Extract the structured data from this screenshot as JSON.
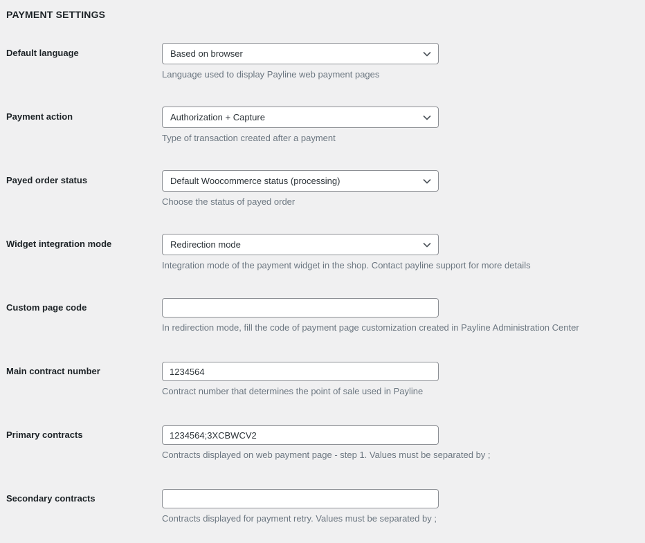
{
  "section": {
    "title": "PAYMENT SETTINGS"
  },
  "icons": {
    "chevron_down": "chevron-down-icon"
  },
  "colors": {
    "background": "#f0f0f1",
    "field_background": "#ffffff",
    "field_border": "#8c8f94",
    "label_text": "#1d2327",
    "value_text": "#2c3338",
    "description_text": "#6c7781"
  },
  "fields": [
    {
      "label": "Default language",
      "type": "select",
      "value": "Based on browser",
      "placeholder": "",
      "description": "Language used to display Payline web payment pages",
      "name": "default-language"
    },
    {
      "label": "Payment action",
      "type": "select",
      "value": "Authorization + Capture",
      "placeholder": "",
      "description": "Type of transaction created after a payment",
      "name": "payment-action"
    },
    {
      "label": "Payed order status",
      "type": "select",
      "value": "Default Woocommerce status (processing)",
      "placeholder": "",
      "description": "Choose the status of payed order",
      "name": "payed-order-status"
    },
    {
      "label": "Widget integration mode",
      "type": "select",
      "value": "Redirection mode",
      "placeholder": "",
      "description": "Integration mode of the payment widget in the shop. Contact payline support for more details",
      "name": "widget-integration-mode"
    },
    {
      "label": "Custom page code",
      "type": "text",
      "value": "",
      "placeholder": "",
      "description": "In redirection mode, fill the code of payment page customization created in Payline Administration Center",
      "name": "custom-page-code"
    },
    {
      "label": "Main contract number",
      "type": "text",
      "value": "1234564",
      "placeholder": "",
      "description": "Contract number that determines the point of sale used in Payline",
      "name": "main-contract-number"
    },
    {
      "label": "Primary contracts",
      "type": "text",
      "value": "1234564;3XCBWCV2",
      "placeholder": "",
      "description": "Contracts displayed on web payment page - step 1. Values must be separated by ;",
      "name": "primary-contracts"
    },
    {
      "label": "Secondary contracts",
      "type": "text",
      "value": "",
      "placeholder": "",
      "description": "Contracts displayed for payment retry. Values must be separated by ;",
      "name": "secondary-contracts"
    }
  ]
}
